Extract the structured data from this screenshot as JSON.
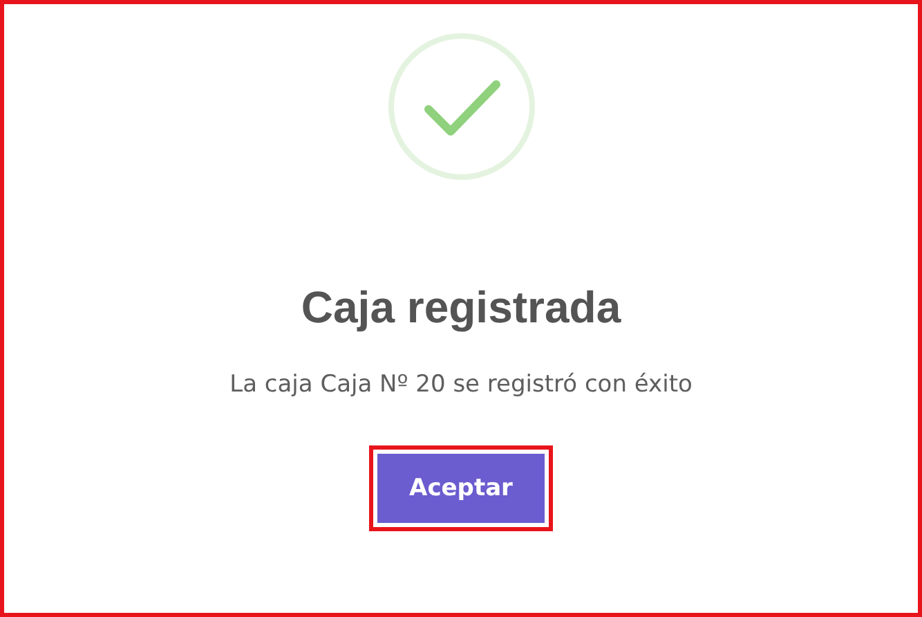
{
  "dialog": {
    "kind": "success",
    "title": "Caja registrada",
    "message": "La caja Caja Nº 20 se registró con éxito",
    "buttons": [
      {
        "label": "Aceptar"
      }
    ]
  }
}
